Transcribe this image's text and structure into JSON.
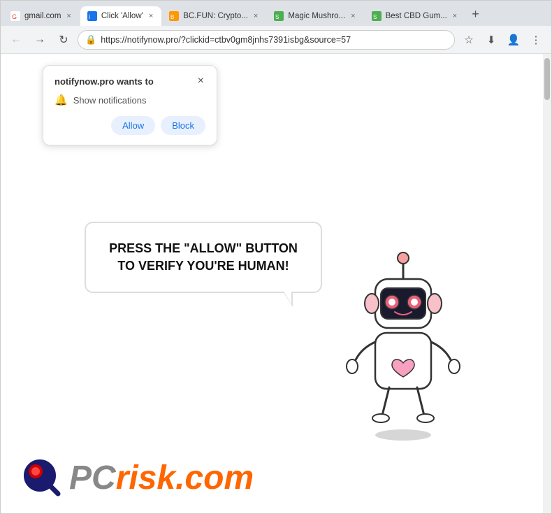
{
  "browser": {
    "tabs": [
      {
        "id": "tab-gmail",
        "label": "gmail.com",
        "favicon_color": "#fff",
        "active": false
      },
      {
        "id": "tab-click-allow",
        "label": "Click 'Allow'",
        "active": true
      },
      {
        "id": "tab-bc-fun",
        "label": "BC.FUN: Crypto...",
        "active": false
      },
      {
        "id": "tab-magic-mushroom",
        "label": "Magic Mushro...",
        "active": false
      },
      {
        "id": "tab-best-cbd",
        "label": "Best CBD Gum...",
        "active": false
      }
    ],
    "address": "https://notifynow.pro/?clickid=ctbv0gm8jnhs7391isbg&source=57",
    "new_tab_label": "+"
  },
  "notification_popup": {
    "title": "notifynow.pro wants to",
    "notification_row": "Show notifications",
    "allow_label": "Allow",
    "block_label": "Block"
  },
  "page": {
    "speech_bubble_text": "PRESS THE \"ALLOW\" BUTTON TO VERIFY YOU'RE HUMAN!"
  },
  "footer_logo": {
    "text_gray": "PC",
    "text_orange": "risk.com"
  },
  "icons": {
    "back": "←",
    "forward": "→",
    "reload": "↻",
    "lock": "🔒",
    "star": "☆",
    "download": "⬇",
    "profile": "👤",
    "menu": "⋮",
    "bell": "🔔",
    "close": "×"
  }
}
